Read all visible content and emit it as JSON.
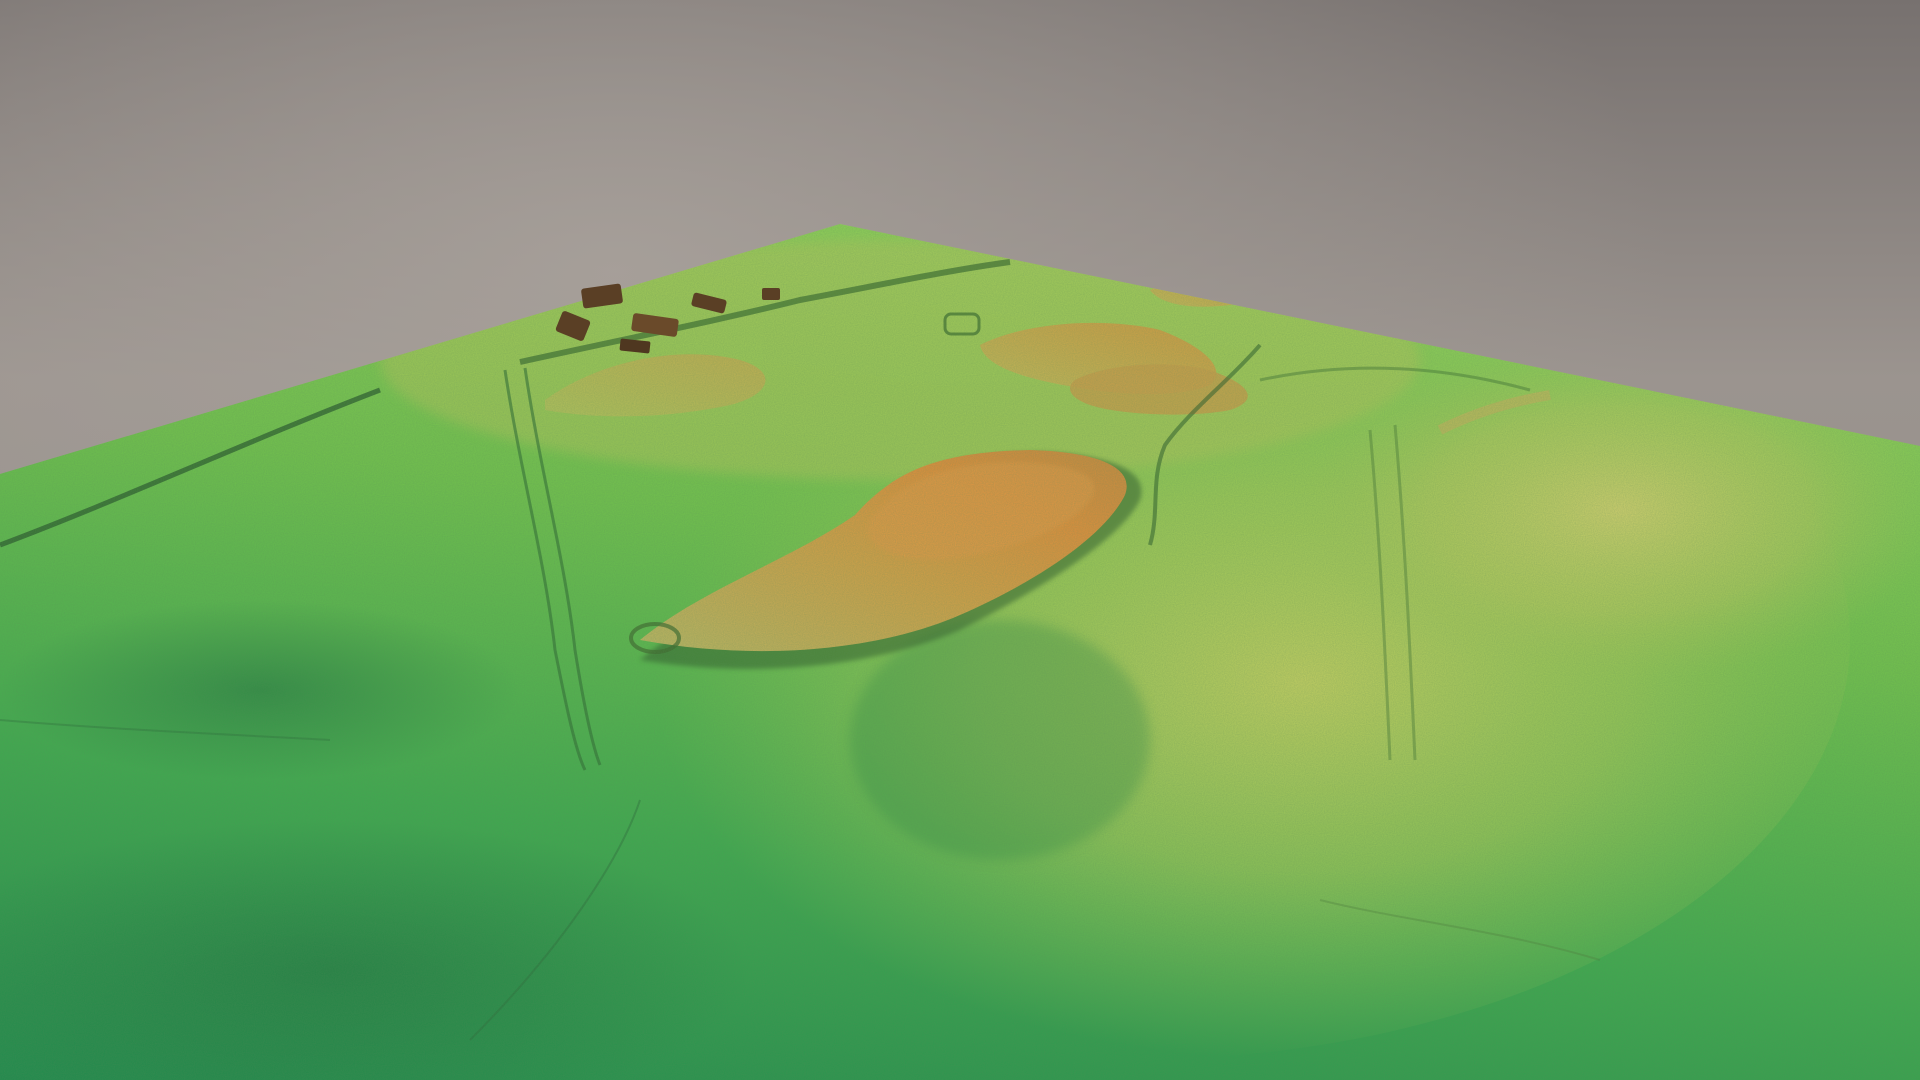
{
  "scene": {
    "subject": "3d-terrain-elevation-model",
    "colors": {
      "sky_top": "#7a7573",
      "sky_mid": "#9a9490",
      "sky_bottom": "#8e8b89",
      "low_elevation": "#2f9a4e",
      "mid_low_elevation": "#5fbf4a",
      "mid_elevation": "#a6c85a",
      "high_elevation": "#c9a54a",
      "peak_elevation": "#d98a3a",
      "shadow": "#1f4a22",
      "building": "#5a3f25"
    }
  }
}
